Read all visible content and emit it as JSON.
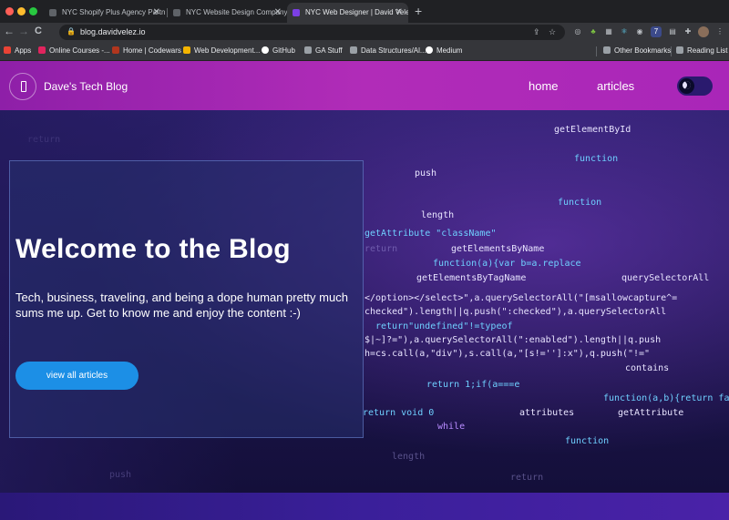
{
  "browser": {
    "tabs": [
      {
        "title": "NYC Shopify Plus Agency Partn",
        "active": false
      },
      {
        "title": "NYC Website Design Company",
        "active": false
      },
      {
        "title": "NYC Web Designer | David Velez",
        "active": true
      }
    ],
    "new_tab_label": "+",
    "url": "blog.davidvelez.io",
    "nav": {
      "back": "←",
      "forward": "→",
      "reload": "C"
    },
    "bookmarks": [
      {
        "label": "Apps",
        "color": "#ea4335"
      },
      {
        "label": "Online Courses -...",
        "color": "#e0245e"
      },
      {
        "label": "Home | Codewars",
        "color": "#b1361e"
      },
      {
        "label": "Web Development...",
        "color": "#f4b400"
      },
      {
        "label": "GitHub",
        "color": "#ffffff"
      },
      {
        "label": "GA Stuff",
        "color": "#9aa0a6"
      },
      {
        "label": "Data Structures/Al...",
        "color": "#9aa0a6"
      },
      {
        "label": "Medium",
        "color": "#ffffff"
      }
    ],
    "other_bookmarks": "Other Bookmarks",
    "reading_list": "Reading List",
    "extension_badge": "7"
  },
  "site": {
    "name": "Dave's Tech Blog",
    "nav": {
      "home": "home",
      "articles": "articles"
    },
    "hero": {
      "title": "Welcome to the Blog",
      "text": "Tech, business, traveling, and being a dope human pretty much sums me up. Get to know me and enjoy the content :-)",
      "cta": "view all articles"
    },
    "colors": {
      "header": "#a926b8",
      "cta": "#1c8fe6"
    }
  },
  "background_code": [
    "getElementById",
    "getAttribute \"className\"",
    "getElementsByName",
    "function(a){var b=a.replace",
    "getElementsByTagName",
    "querySelectorAll",
    "</option></select>\",a.querySelectorAll(\"[msallowcapture^=",
    "checked\").length||q.push(\":checked\"),a.querySelectorAll",
    "return\"undefined\"!=typeof",
    "$|~]?=\"),a.querySelectorAll(\":enabled\").length||q.push",
    "h=cs.call(a,\"div\"),s.call(a,\"[s!='']:x\"),q.push(\"!=\"",
    "contains",
    "return 1;if(a===e",
    "function(a,b){return fa",
    "attributes",
    "getAttribute",
    "return void 0",
    "while",
    "function",
    "length",
    "push",
    "return"
  ]
}
